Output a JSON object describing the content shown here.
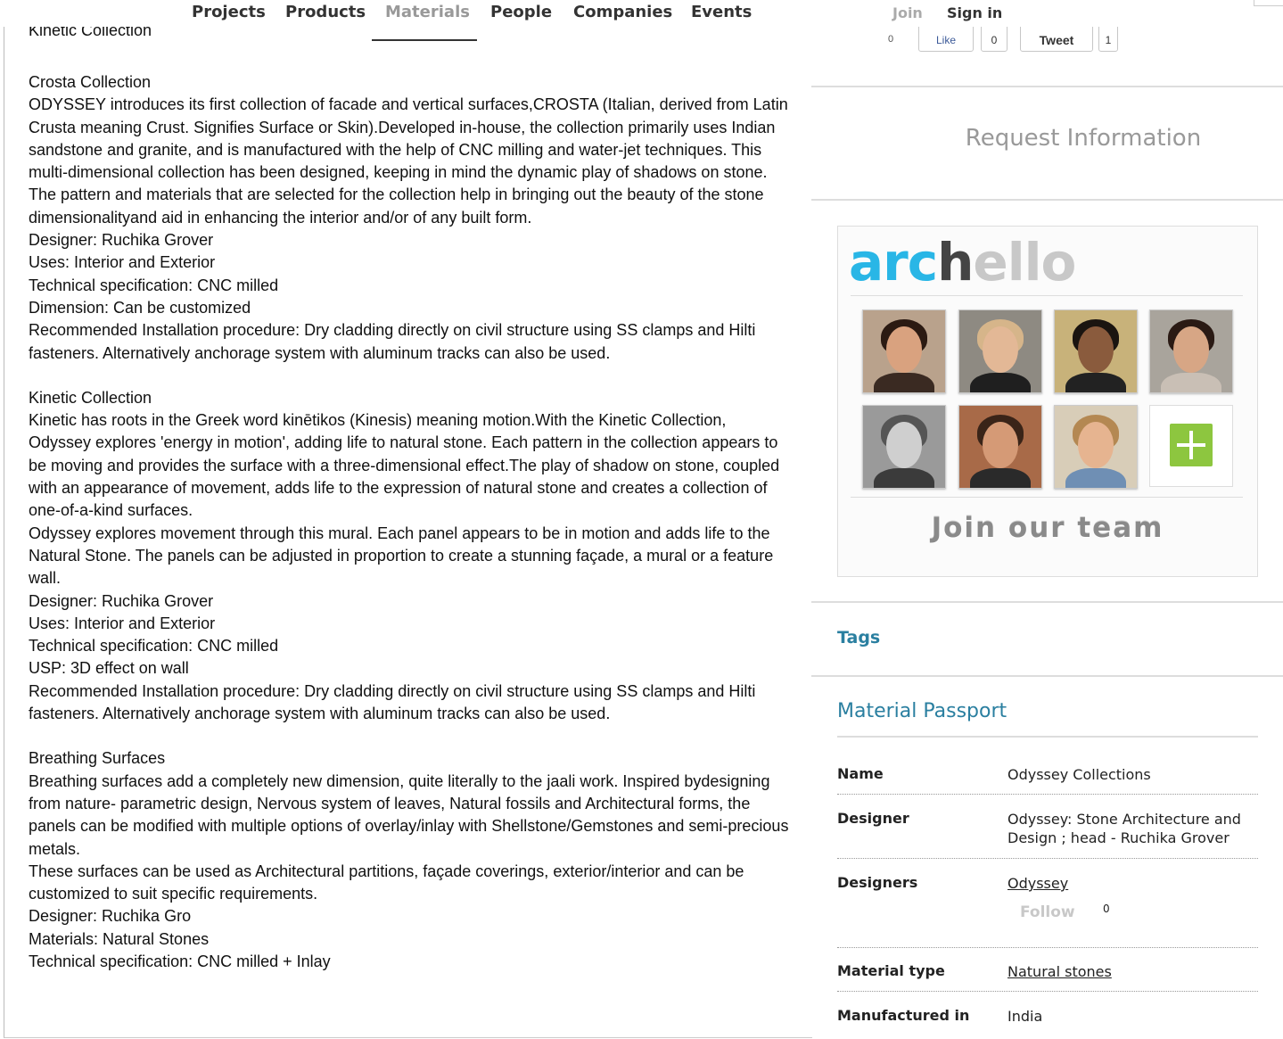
{
  "nav": {
    "items": [
      {
        "label": "Projects"
      },
      {
        "label": "Products"
      },
      {
        "label": "Materials"
      },
      {
        "label": "People"
      },
      {
        "label": "Companies"
      },
      {
        "label": "Events"
      }
    ],
    "active": "Materials",
    "join": "Join",
    "sign_in": "Sign in"
  },
  "article": {
    "cut_heading": "Kinetic Collection",
    "sections": [
      {
        "title": "Crosta Collection",
        "lines": [
          "ODYSSEY introduces its first collection of facade and vertical surfaces,CROSTA (Italian, derived from Latin Crusta meaning Crust. Signifies Surface or Skin).Developed in-house, the collection primarily uses Indian sandstone and granite, and is manufactured with the help of CNC milling and water-jet techniques. This multi-dimensional collection has been designed, keeping in mind the dynamic play of shadows on stone. The pattern and materials that are selected for the collection help in bringing out the beauty of the stone dimensionalityand aid in enhancing the interior and/or of any built form.",
          "Designer: Ruchika Grover",
          "Uses: Interior and Exterior",
          "Technical specification: CNC milled",
          "Dimension: Can be customized",
          "Recommended Installation procedure: Dry cladding directly on civil structure using SS clamps and Hilti fasteners. Alternatively anchorage system with aluminum tracks can also be used."
        ]
      },
      {
        "title": "Kinetic Collection",
        "lines": [
          "Kinetic has roots in the Greek word kinētikos (Kinesis) meaning motion.With the Kinetic Collection, Odyssey explores 'energy in motion', adding life to natural stone. Each pattern in the collection appears to be moving and provides the surface with a three-dimensional effect.The play of shadow on stone, coupled with an appearance of movement, adds life to the expression of natural stone and creates a collection of one-of-a-kind surfaces.",
          "Odyssey explores movement through this mural. Each panel appears to be in motion and adds life to the Natural Stone. The panels can be adjusted in proportion to create a stunning façade, a mural or a feature wall.",
          "Designer: Ruchika Grover",
          "Uses: Interior and Exterior",
          "Technical specification: CNC milled",
          "USP: 3D effect on wall",
          "Recommended Installation procedure: Dry cladding directly on civil structure using SS clamps and Hilti fasteners. Alternatively anchorage system with aluminum tracks can also be used."
        ]
      },
      {
        "title": "Breathing Surfaces",
        "lines": [
          "Breathing surfaces add a completely new dimension, quite literally to the jaali work. Inspired bydesigning from nature- parametric design, Nervous system of leaves, Natural fossils and Architectural forms, the panels can be modified with multiple options of overlay/inlay with Shellstone/Gemstones and semi-precious metals.",
          "These surfaces can be used as Architectural partitions, façade coverings, exterior/interior and can be customized to suit specific requirements.",
          "Designer: Ruchika Gro",
          "Materials: Natural Stones",
          "Technical specification: CNC milled + Inlay"
        ]
      }
    ]
  },
  "social": {
    "like_label": "Like",
    "like_count": "0",
    "tweet_label": "Tweet",
    "tweet_count": "1",
    "zero": "0"
  },
  "sidebar": {
    "request_info": "Request Information",
    "ad": {
      "logo_part1": "arc",
      "logo_part2": "h",
      "logo_part3": "ello",
      "join_text": "Join our team"
    },
    "tags_title": "Tags",
    "passport_title": "Material Passport",
    "passport": {
      "name_k": "Name",
      "name_v": "Odyssey Collections",
      "designer_k": "Designer",
      "designer_v": "Odyssey: Stone Architecture and Design ; head - Ruchika Grover",
      "designers_k": "Designers",
      "designers_v": "Odyssey",
      "follow_label": "Follow",
      "follow_count": "0",
      "material_type_k": "Material type",
      "material_type_v": "Natural stones",
      "manufactured_k": "Manufactured in",
      "manufactured_v": "India"
    }
  },
  "colors": {
    "accent": "#2a7fa0",
    "archello_blue": "#29b6e6",
    "plus_green": "#8dc63f"
  }
}
